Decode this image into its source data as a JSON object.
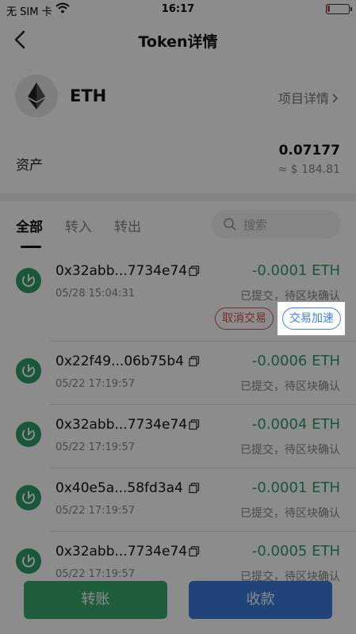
{
  "status_bar": {
    "carrier": "无 SIM 卡",
    "time": "16:17"
  },
  "nav": {
    "title": "Token详情"
  },
  "token": {
    "symbol": "ETH",
    "project_link": "项目详情",
    "logo_icon": "ethereum-icon"
  },
  "assets": {
    "label": "资产",
    "amount": "0.07177",
    "fiat": "≈ $ 184.81"
  },
  "tabs": [
    {
      "label": "全部",
      "active": true
    },
    {
      "label": "转入",
      "active": false
    },
    {
      "label": "转出",
      "active": false
    }
  ],
  "search": {
    "placeholder": "搜索"
  },
  "transactions": [
    {
      "hash": "0x32abb...7734e74",
      "date": "05/28 15:04:31",
      "amount": "-0.0001 ETH",
      "status": "已提交，待区块确认"
    },
    {
      "hash": "0x22f49...06b75b4",
      "date": "05/22 17:19:57",
      "amount": "-0.0006 ETH",
      "status": "已提交，待区块确认"
    },
    {
      "hash": "0x32abb...7734e74",
      "date": "05/22 17:19:57",
      "amount": "-0.0004 ETH",
      "status": "已提交，待区块确认"
    },
    {
      "hash": "0x40e5a...58fd3a4",
      "date": "05/22 17:19:57",
      "amount": "-0.0001 ETH",
      "status": "已提交，待区块确认"
    },
    {
      "hash": "0x32abb...7734e74",
      "date": "05/22 17:19:57",
      "amount": "-0.0005 ETH",
      "status": "已提交，待区块确认"
    }
  ],
  "tx_actions": {
    "cancel": "取消交易",
    "speed_up": "交易加速"
  },
  "bottom": {
    "transfer": "转账",
    "receive": "收款"
  },
  "colors": {
    "green": "#2e9e66",
    "blue": "#3b7ddd",
    "red": "#d9534f"
  }
}
